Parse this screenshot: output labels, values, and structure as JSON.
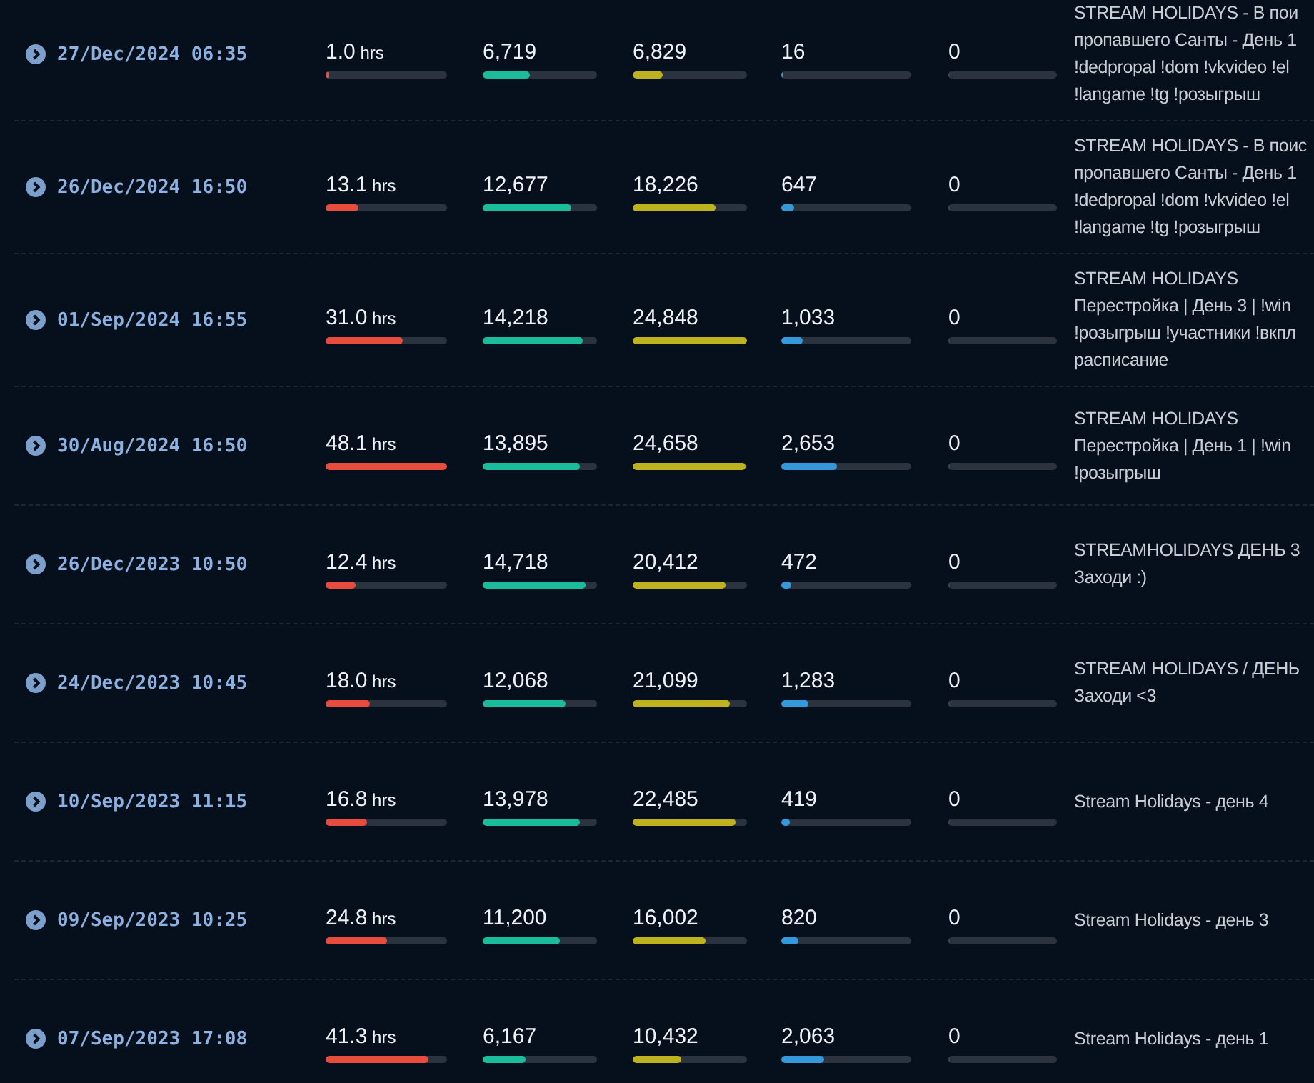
{
  "streams": [
    {
      "date": "27/Dec/2024 06:35",
      "metrics": [
        {
          "value": "1.0",
          "unit": "hrs",
          "level": 0.02,
          "color": "#e74c3c"
        },
        {
          "value": "6,719",
          "level": 0.41,
          "color": "#1abc9c"
        },
        {
          "value": "6,829",
          "level": 0.26,
          "color": "#bfb21f"
        },
        {
          "value": "16",
          "level": 0,
          "color": "#3498db"
        },
        {
          "value": "0",
          "level": 0
        }
      ],
      "title_lines": [
        "STREAM HOLIDAYS - В пои",
        "пропавшего Санты - День 1",
        "!dedpropal !dom !vkvideo !el",
        "!langame !tg !розыгрыш"
      ]
    },
    {
      "date": "26/Dec/2024 16:50",
      "metrics": [
        {
          "value": "13.1",
          "unit": "hrs",
          "level": 0.27,
          "color": "#e74c3c"
        },
        {
          "value": "12,677",
          "level": 0.78,
          "color": "#1abc9c"
        },
        {
          "value": "18,226",
          "level": 0.73,
          "color": "#bfb21f"
        },
        {
          "value": "647",
          "level": 0.1,
          "color": "#3498db"
        },
        {
          "value": "0",
          "level": 0
        }
      ],
      "title_lines": [
        "STREAM HOLIDAYS - В поис",
        "пропавшего Санты - День 1",
        "!dedpropal !dom !vkvideo !el",
        "!langame !tg !розыгрыш"
      ]
    },
    {
      "date": "01/Sep/2024 16:55",
      "metrics": [
        {
          "value": "31.0",
          "unit": "hrs",
          "level": 0.64,
          "color": "#e74c3c"
        },
        {
          "value": "14,218",
          "level": 0.88,
          "color": "#1abc9c"
        },
        {
          "value": "24,848",
          "level": 1.0,
          "color": "#bfb21f"
        },
        {
          "value": "1,033",
          "level": 0.16,
          "color": "#3498db"
        },
        {
          "value": "0",
          "level": 0
        }
      ],
      "title_lines": [
        "STREAM HOLIDAYS",
        "Перестройка | День 3 | !win",
        "!розыгрыш !участники !вкпл",
        "расписание"
      ]
    },
    {
      "date": "30/Aug/2024 16:50",
      "metrics": [
        {
          "value": "48.1",
          "unit": "hrs",
          "level": 1.0,
          "color": "#e74c3c"
        },
        {
          "value": "13,895",
          "level": 0.85,
          "color": "#1abc9c"
        },
        {
          "value": "24,658",
          "level": 0.99,
          "color": "#bfb21f"
        },
        {
          "value": "2,653",
          "level": 0.43,
          "color": "#3498db"
        },
        {
          "value": "0",
          "level": 0
        }
      ],
      "title_lines": [
        "STREAM HOLIDAYS",
        "Перестройка | День 1 | !win",
        "!розыгрыш"
      ]
    },
    {
      "date": "26/Dec/2023 10:50",
      "metrics": [
        {
          "value": "12.4",
          "unit": "hrs",
          "level": 0.25,
          "color": "#e74c3c"
        },
        {
          "value": "14,718",
          "level": 0.9,
          "color": "#1abc9c"
        },
        {
          "value": "20,412",
          "level": 0.81,
          "color": "#bfb21f"
        },
        {
          "value": "472",
          "level": 0.08,
          "color": "#3498db"
        },
        {
          "value": "0",
          "level": 0
        }
      ],
      "title_lines": [
        "STREAMHOLIDAYS ДЕНЬ 3",
        "Заходи :)"
      ]
    },
    {
      "date": "24/Dec/2023 10:45",
      "metrics": [
        {
          "value": "18.0",
          "unit": "hrs",
          "level": 0.36,
          "color": "#e74c3c"
        },
        {
          "value": "12,068",
          "level": 0.72,
          "color": "#1abc9c"
        },
        {
          "value": "21,099",
          "level": 0.85,
          "color": "#bfb21f"
        },
        {
          "value": "1,283",
          "level": 0.21,
          "color": "#3498db"
        },
        {
          "value": "0",
          "level": 0
        }
      ],
      "title_lines": [
        "STREAM HOLIDAYS / ДЕНЬ",
        "Заходи <3"
      ]
    },
    {
      "date": "10/Sep/2023 11:15",
      "metrics": [
        {
          "value": "16.8",
          "unit": "hrs",
          "level": 0.34,
          "color": "#e74c3c"
        },
        {
          "value": "13,978",
          "level": 0.85,
          "color": "#1abc9c"
        },
        {
          "value": "22,485",
          "level": 0.9,
          "color": "#bfb21f"
        },
        {
          "value": "419",
          "level": 0.07,
          "color": "#3498db"
        },
        {
          "value": "0",
          "level": 0
        }
      ],
      "title_lines": [
        "Stream Holidays - день 4"
      ]
    },
    {
      "date": "09/Sep/2023 10:25",
      "metrics": [
        {
          "value": "24.8",
          "unit": "hrs",
          "level": 0.51,
          "color": "#e74c3c"
        },
        {
          "value": "11,200",
          "level": 0.68,
          "color": "#1abc9c"
        },
        {
          "value": "16,002",
          "level": 0.64,
          "color": "#bfb21f"
        },
        {
          "value": "820",
          "level": 0.13,
          "color": "#3498db"
        },
        {
          "value": "0",
          "level": 0
        }
      ],
      "title_lines": [
        "Stream Holidays - день 3"
      ]
    },
    {
      "date": "07/Sep/2023 17:08",
      "metrics": [
        {
          "value": "41.3",
          "unit": "hrs",
          "level": 0.85,
          "color": "#e74c3c"
        },
        {
          "value": "6,167",
          "level": 0.38,
          "color": "#1abc9c"
        },
        {
          "value": "10,432",
          "level": 0.42,
          "color": "#bfb21f"
        },
        {
          "value": "2,063",
          "level": 0.33,
          "color": "#3498db"
        },
        {
          "value": "0",
          "level": 0
        }
      ],
      "title_lines": [
        "Stream Holidays - день 1"
      ]
    }
  ]
}
